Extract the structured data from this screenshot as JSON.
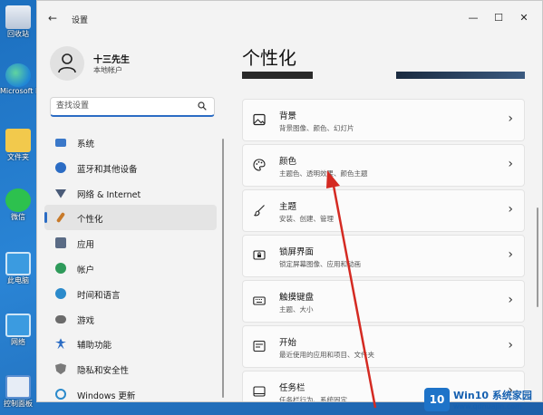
{
  "desktop": {
    "icons": [
      {
        "label": "回收站",
        "icon": "recycle-bin-icon"
      },
      {
        "label": "Microsoft Edge",
        "icon": "edge-icon"
      },
      {
        "label": "文件夹",
        "icon": "folder-icon"
      },
      {
        "label": "微信",
        "icon": "wechat-icon"
      },
      {
        "label": "此电脑",
        "icon": "computer-icon"
      },
      {
        "label": "网络",
        "icon": "network-icon"
      },
      {
        "label": "控制面板",
        "icon": "control-panel-icon"
      }
    ]
  },
  "window": {
    "title": "设置",
    "controls": {
      "minimize": "—",
      "maximize": "☐",
      "close": "✕"
    }
  },
  "user": {
    "name": "十三先生",
    "account_type": "本地帐户"
  },
  "search": {
    "placeholder": "查找设置"
  },
  "sidebar": {
    "items": [
      {
        "label": "系统",
        "icon": "monitor-icon",
        "color": "#3a78c9"
      },
      {
        "label": "蓝牙和其他设备",
        "icon": "bluetooth-icon",
        "color": "#2b6cc4"
      },
      {
        "label": "网络 & Internet",
        "icon": "wifi-icon",
        "color": "#4a5b78"
      },
      {
        "label": "个性化",
        "icon": "brush-icon",
        "color": "#c87a2a",
        "active": true
      },
      {
        "label": "应用",
        "icon": "apps-icon",
        "color": "#5a6b85"
      },
      {
        "label": "帐户",
        "icon": "account-icon",
        "color": "#2e9a5a"
      },
      {
        "label": "时间和语言",
        "icon": "globe-clock-icon",
        "color": "#2b8acb"
      },
      {
        "label": "游戏",
        "icon": "gamepad-icon",
        "color": "#6b6b6b"
      },
      {
        "label": "辅助功能",
        "icon": "accessibility-icon",
        "color": "#2b6cc4"
      },
      {
        "label": "隐私和安全性",
        "icon": "shield-icon",
        "color": "#7a7a7a"
      },
      {
        "label": "Windows 更新",
        "icon": "update-icon",
        "color": "#2b8acb"
      }
    ]
  },
  "main": {
    "title": "个性化",
    "rows": [
      {
        "title": "背景",
        "subtitle": "背景图像、颜色、幻灯片",
        "icon": "image-icon"
      },
      {
        "title": "颜色",
        "subtitle": "主题色、透明效果、颜色主题",
        "icon": "palette-icon"
      },
      {
        "title": "主题",
        "subtitle": "安装、创建、管理",
        "icon": "brush-icon"
      },
      {
        "title": "锁屏界面",
        "subtitle": "锁定屏幕图像、应用和动画",
        "icon": "lock-screen-icon"
      },
      {
        "title": "触摸键盘",
        "subtitle": "主题、大小",
        "icon": "keyboard-icon"
      },
      {
        "title": "开始",
        "subtitle": "最近使用的应用和项目、文件夹",
        "icon": "start-icon"
      },
      {
        "title": "任务栏",
        "subtitle": "任务栏行为、系统固定",
        "icon": "taskbar-icon"
      }
    ],
    "chevron": "›"
  },
  "watermark": {
    "logo": "10",
    "title": "Win10 系统家园",
    "url": "www.qdhuajin.com"
  },
  "colors": {
    "accent": "#2b6cc4",
    "annotation_arrow": "#d42a22"
  }
}
